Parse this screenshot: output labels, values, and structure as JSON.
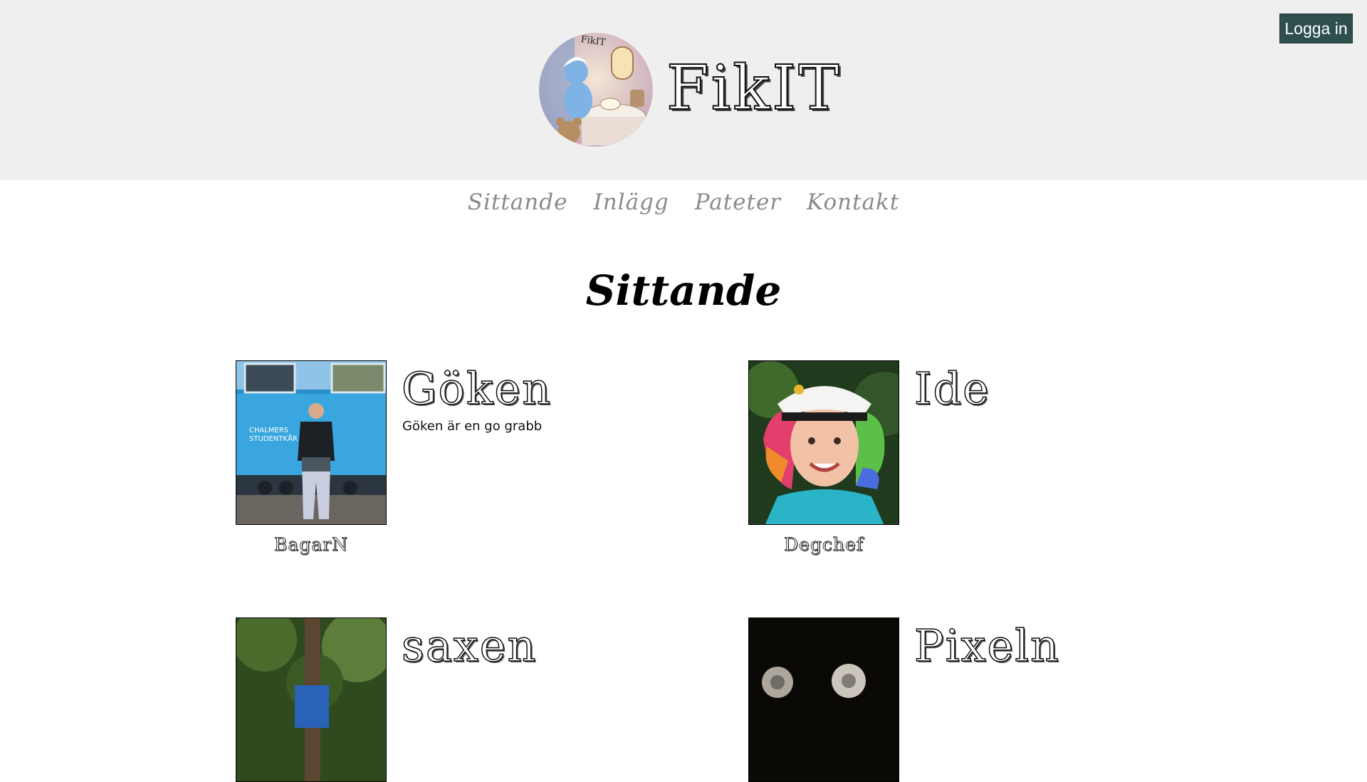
{
  "header": {
    "site_title": "FikIT",
    "logo_text": "FikIT",
    "login_label": "Logga in",
    "background_color": "#efefef",
    "login_color": "#2f4f4f"
  },
  "nav": {
    "items": [
      {
        "label": "Sittande"
      },
      {
        "label": "Inlägg"
      },
      {
        "label": "Pateter"
      },
      {
        "label": "Kontakt"
      }
    ]
  },
  "main": {
    "heading": "Sittande",
    "members": [
      {
        "name": "Göken",
        "description": "Göken är en go grabb",
        "role": "BagarN",
        "photo": "person-by-blue-train-photo"
      },
      {
        "name": "Ide",
        "description": "",
        "role": "Degchef",
        "photo": "person-with-rainbow-hair-and-captain-hat-photo"
      },
      {
        "name": "saxen",
        "description": "",
        "role": "",
        "photo": "person-in-forest-photo"
      },
      {
        "name": "Pixeln",
        "description": "",
        "role": "",
        "photo": "dark-photo-with-lights"
      }
    ]
  }
}
